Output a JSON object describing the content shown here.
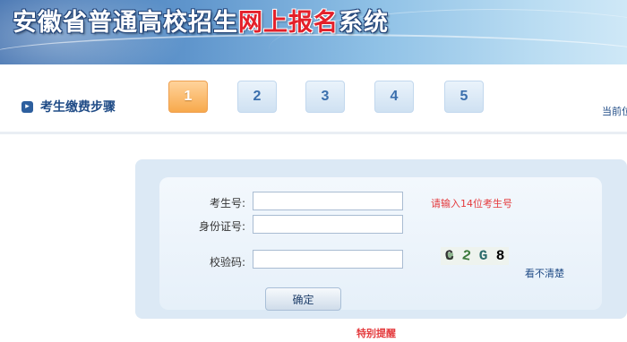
{
  "header": {
    "title_prefix": "安徽省普通高校招生",
    "title_highlight": "网上报名",
    "title_suffix": "系统",
    "colors": {
      "banner_blue": "#4f84c0",
      "highlight_red": "#e3202a"
    }
  },
  "steps": {
    "label": "考生缴费步骤",
    "icon": "arrow-right-icon",
    "items": [
      {
        "number": "1",
        "state": "active"
      },
      {
        "number": "2",
        "state": "inactive"
      },
      {
        "number": "3",
        "state": "inactive"
      },
      {
        "number": "4",
        "state": "inactive"
      },
      {
        "number": "5",
        "state": "inactive"
      }
    ],
    "current_label": "当前位",
    "colors": {
      "active": "#f7a94c",
      "inactive": "#cfe1f2"
    }
  },
  "form": {
    "exam_number": {
      "label": "考生号:",
      "value": "",
      "hint": "请输入14位考生号"
    },
    "id_number": {
      "label": "身份证号:",
      "value": ""
    },
    "captcha": {
      "label": "校验码:",
      "value": "",
      "image_chars": [
        "C",
        "2",
        "G",
        "8"
      ],
      "refresh_label": "看不清楚"
    },
    "submit_label": "确定"
  },
  "notice": {
    "label": "特别提醒",
    "color": "#e4393c"
  }
}
